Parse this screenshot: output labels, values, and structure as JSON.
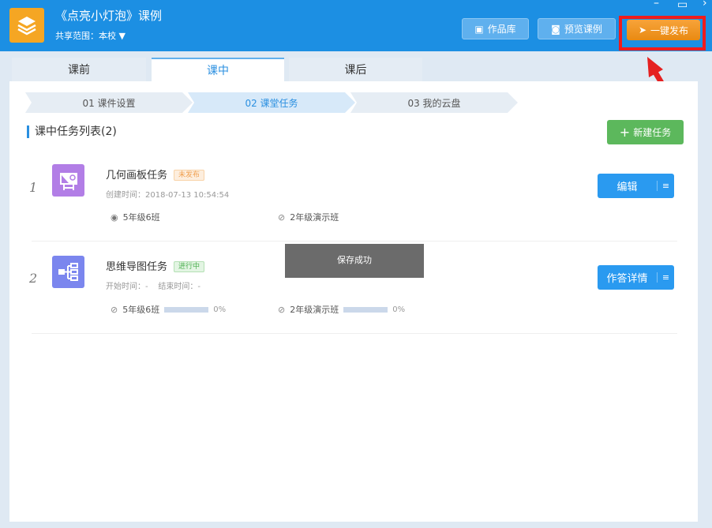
{
  "header": {
    "title": "《点亮小灯泡》课例",
    "scope_label": "共享范围：本校",
    "buttons": {
      "works": "作品库",
      "preview": "预览课例",
      "publish": "一键发布"
    }
  },
  "tabs": [
    {
      "label": "课前"
    },
    {
      "label": "课中"
    },
    {
      "label": "课后"
    }
  ],
  "steps": [
    {
      "label": "01 课件设置"
    },
    {
      "label": "02 课堂任务"
    },
    {
      "label": "03 我的云盘"
    }
  ],
  "section": {
    "title": "课中任务列表(2)",
    "new_task": "新建任务"
  },
  "tasks": [
    {
      "index": "1",
      "name": "几何画板任务",
      "status": "未发布",
      "meta": "创建时间：2018-07-13 10:54:54",
      "classes": [
        {
          "name": "5年级6班"
        },
        {
          "name": "2年级演示班"
        }
      ],
      "action": "编辑"
    },
    {
      "index": "2",
      "name": "思维导图任务",
      "status": "进行中",
      "meta": "开始时间：-    结束时间：-",
      "classes": [
        {
          "name": "5年级6班",
          "progress": "0%"
        },
        {
          "name": "2年级演示班",
          "progress": "0%"
        }
      ],
      "action": "作答详情"
    }
  ],
  "toast": "保存成功",
  "colors": {
    "header": "#1c8fe3",
    "publish": "#f39a1e",
    "green": "#5cb85c",
    "highlight": "#ef1c1c"
  }
}
